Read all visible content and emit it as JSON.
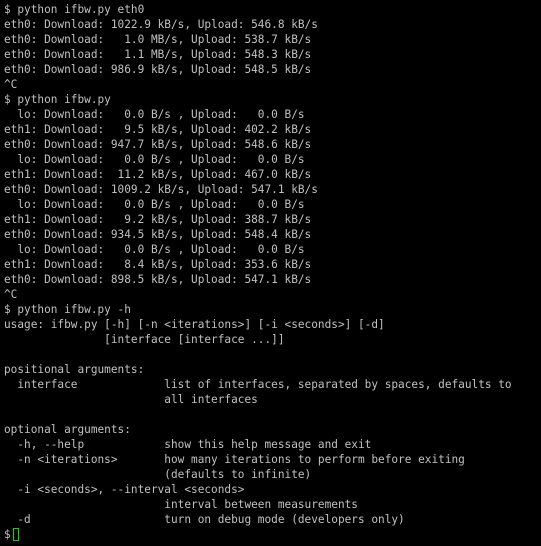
{
  "terminal": {
    "lines": [
      "$ python ifbw.py eth0",
      "eth0: Download: 1022.9 kB/s, Upload: 546.8 kB/s",
      "eth0: Download:   1.0 MB/s, Upload: 538.7 kB/s",
      "eth0: Download:   1.1 MB/s, Upload: 548.3 kB/s",
      "eth0: Download: 986.9 kB/s, Upload: 548.5 kB/s",
      "^C",
      "$ python ifbw.py",
      "  lo: Download:   0.0 B/s , Upload:   0.0 B/s",
      "eth1: Download:   9.5 kB/s, Upload: 402.2 kB/s",
      "eth0: Download: 947.7 kB/s, Upload: 548.6 kB/s",
      "  lo: Download:   0.0 B/s , Upload:   0.0 B/s",
      "eth1: Download:  11.2 kB/s, Upload: 467.0 kB/s",
      "eth0: Download: 1009.2 kB/s, Upload: 547.1 kB/s",
      "  lo: Download:   0.0 B/s , Upload:   0.0 B/s",
      "eth1: Download:   9.2 kB/s, Upload: 388.7 kB/s",
      "eth0: Download: 934.5 kB/s, Upload: 548.4 kB/s",
      "  lo: Download:   0.0 B/s , Upload:   0.0 B/s",
      "eth1: Download:   8.4 kB/s, Upload: 353.6 kB/s",
      "eth0: Download: 898.5 kB/s, Upload: 547.1 kB/s",
      "^C",
      "$ python ifbw.py -h",
      "usage: ifbw.py [-h] [-n <iterations>] [-i <seconds>] [-d]",
      "               [interface [interface ...]]",
      "",
      "positional arguments:",
      "  interface             list of interfaces, separated by spaces, defaults to",
      "                        all interfaces",
      "",
      "optional arguments:",
      "  -h, --help            show this help message and exit",
      "  -n <iterations>       how many iterations to perform before exiting",
      "                        (defaults to infinite)",
      "  -i <seconds>, --interval <seconds>",
      "                        interval between measurements",
      "  -d                    turn on debug mode (developers only)"
    ],
    "prompt": "$",
    "colors": {
      "background": "#000000",
      "text": "#c0c0c0",
      "cursor": "#00e000"
    }
  }
}
